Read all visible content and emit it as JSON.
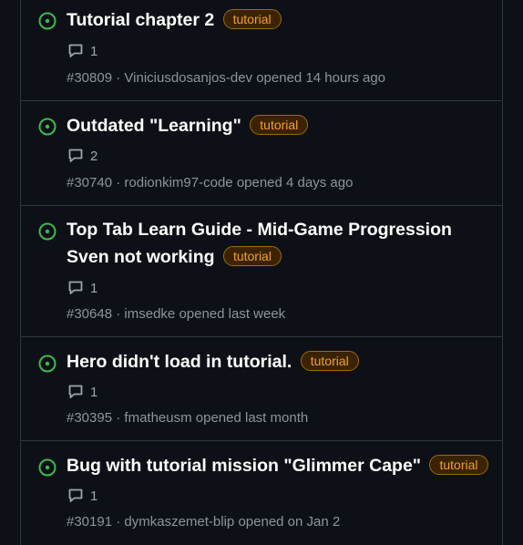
{
  "issues": [
    {
      "title": "Tutorial chapter 2",
      "label": "tutorial",
      "comments": "1",
      "number": "#30809",
      "author": "Viniciusdosanjos-dev",
      "opened": "opened 14 hours ago"
    },
    {
      "title": "Outdated \"Learning\"",
      "label": "tutorial",
      "comments": "2",
      "number": "#30740",
      "author": "rodionkim97-code",
      "opened": "opened 4 days ago"
    },
    {
      "title": "Top Tab Learn Guide - Mid-Game Progression Sven not working",
      "label": "tutorial",
      "comments": "1",
      "number": "#30648",
      "author": "imsedke",
      "opened": "opened last week"
    },
    {
      "title": "Hero didn't load in tutorial.",
      "label": "tutorial",
      "comments": "1",
      "number": "#30395",
      "author": "fmatheusm",
      "opened": "opened last month"
    },
    {
      "title": "Bug with tutorial mission \"Glimmer Cape\"",
      "label": "tutorial",
      "comments": "1",
      "number": "#30191",
      "author": "dymkaszemet-blip",
      "opened": "opened on Jan 2"
    }
  ],
  "meta_separator": "·",
  "icons": {
    "status": "issue-opened-icon",
    "comments": "comment-icon"
  },
  "colors": {
    "background": "#0d1117",
    "open_icon": "#3fb950",
    "label_text": "#f0a030",
    "label_border": "#9e6a03",
    "label_background": "#3b2300"
  }
}
